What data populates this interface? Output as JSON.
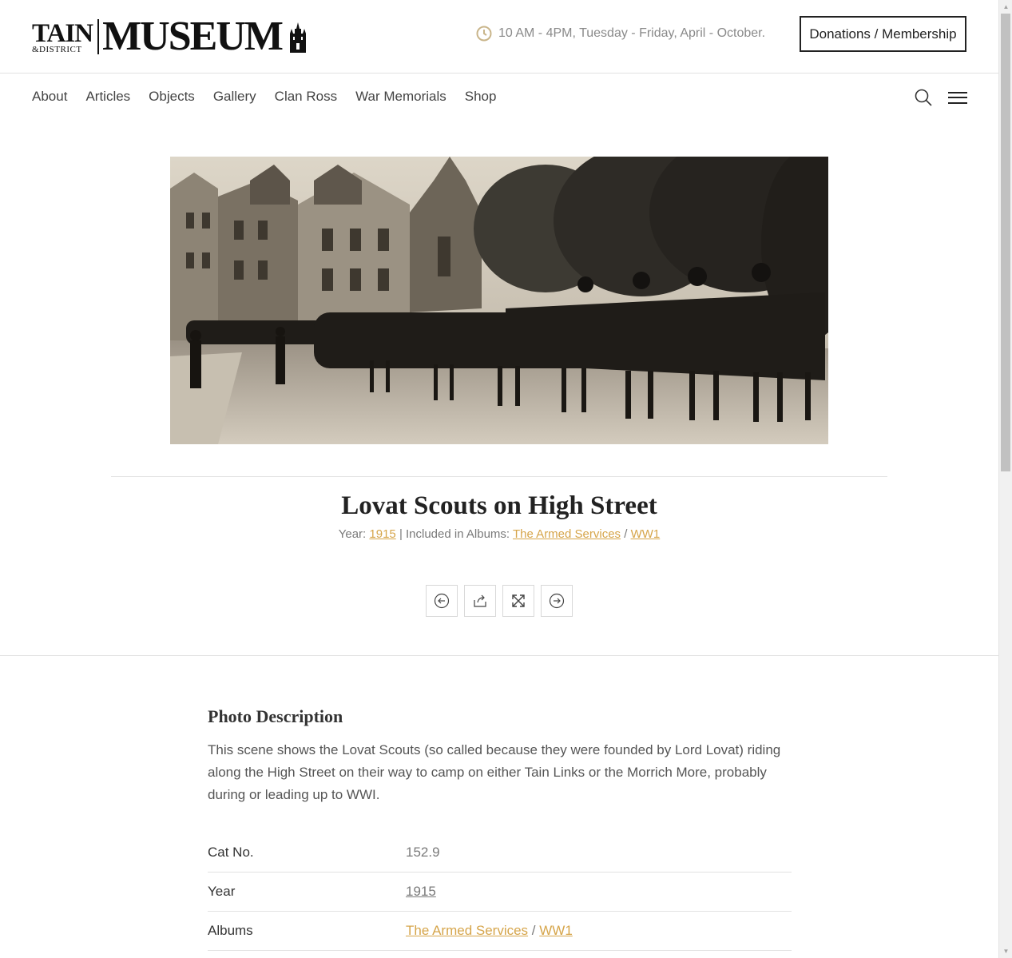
{
  "header": {
    "logo": {
      "tain": "TAIN",
      "district": "&DISTRICT",
      "museum": "MUSEUM"
    },
    "hours": "10 AM - 4PM, Tuesday - Friday, April - October.",
    "donate_label": "Donations / Membership"
  },
  "nav": {
    "items": [
      "About",
      "Articles",
      "Objects",
      "Gallery",
      "Clan Ross",
      "War Memorials",
      "Shop"
    ]
  },
  "photo": {
    "title": "Lovat Scouts on High Street",
    "year_label": "Year:",
    "year": "1915",
    "albums_label": "| Included in Albums:",
    "album_1": "The Armed Services",
    "album_sep": "/",
    "album_2": "WW1"
  },
  "description": {
    "heading": "Photo Description",
    "text": "This scene shows the Lovat Scouts (so called because they were founded by Lord Lovat) riding along the High Street on their way to camp on either Tain Links or the Morrich More, probably during or leading up to WWI."
  },
  "details": {
    "cat_label": "Cat No.",
    "cat_value": "152.9",
    "year_label": "Year",
    "year_value": "1915",
    "albums_label": "Albums",
    "album_1": "The Armed Services",
    "album_sep": "/",
    "album_2": "WW1"
  },
  "colors": {
    "link": "#d6a54a",
    "text": "#333333",
    "muted": "#7a7a7a"
  }
}
